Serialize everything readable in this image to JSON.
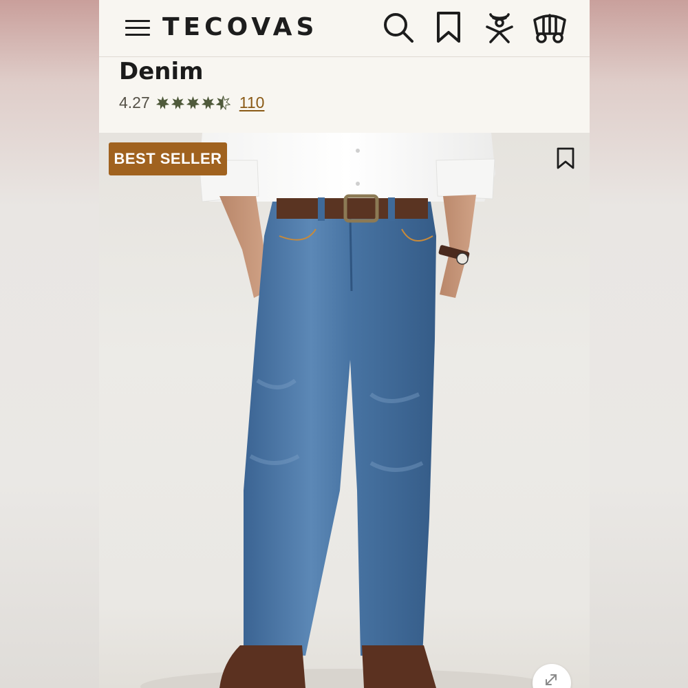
{
  "header": {
    "brand": "TECOVAS",
    "icons": [
      "menu-icon",
      "search-icon",
      "bookmark-icon",
      "account-icon",
      "cart-wagon-icon"
    ]
  },
  "product": {
    "title": "Denim",
    "rating": "4.27",
    "rating_value": 4.27,
    "rating_max": 5,
    "review_count": "110"
  },
  "image": {
    "badge": "BEST SELLER",
    "icons": [
      "bookmark-icon",
      "expand-icon"
    ],
    "subject": "model wearing medium-wash bootcut jeans, white shirt, brown belt, brown boots"
  },
  "colors": {
    "background": "#f8f6f1",
    "text": "#1d1d1d",
    "rating_star": "#4f5a3b",
    "link": "#8a5a16",
    "badge": "#a0621f"
  }
}
